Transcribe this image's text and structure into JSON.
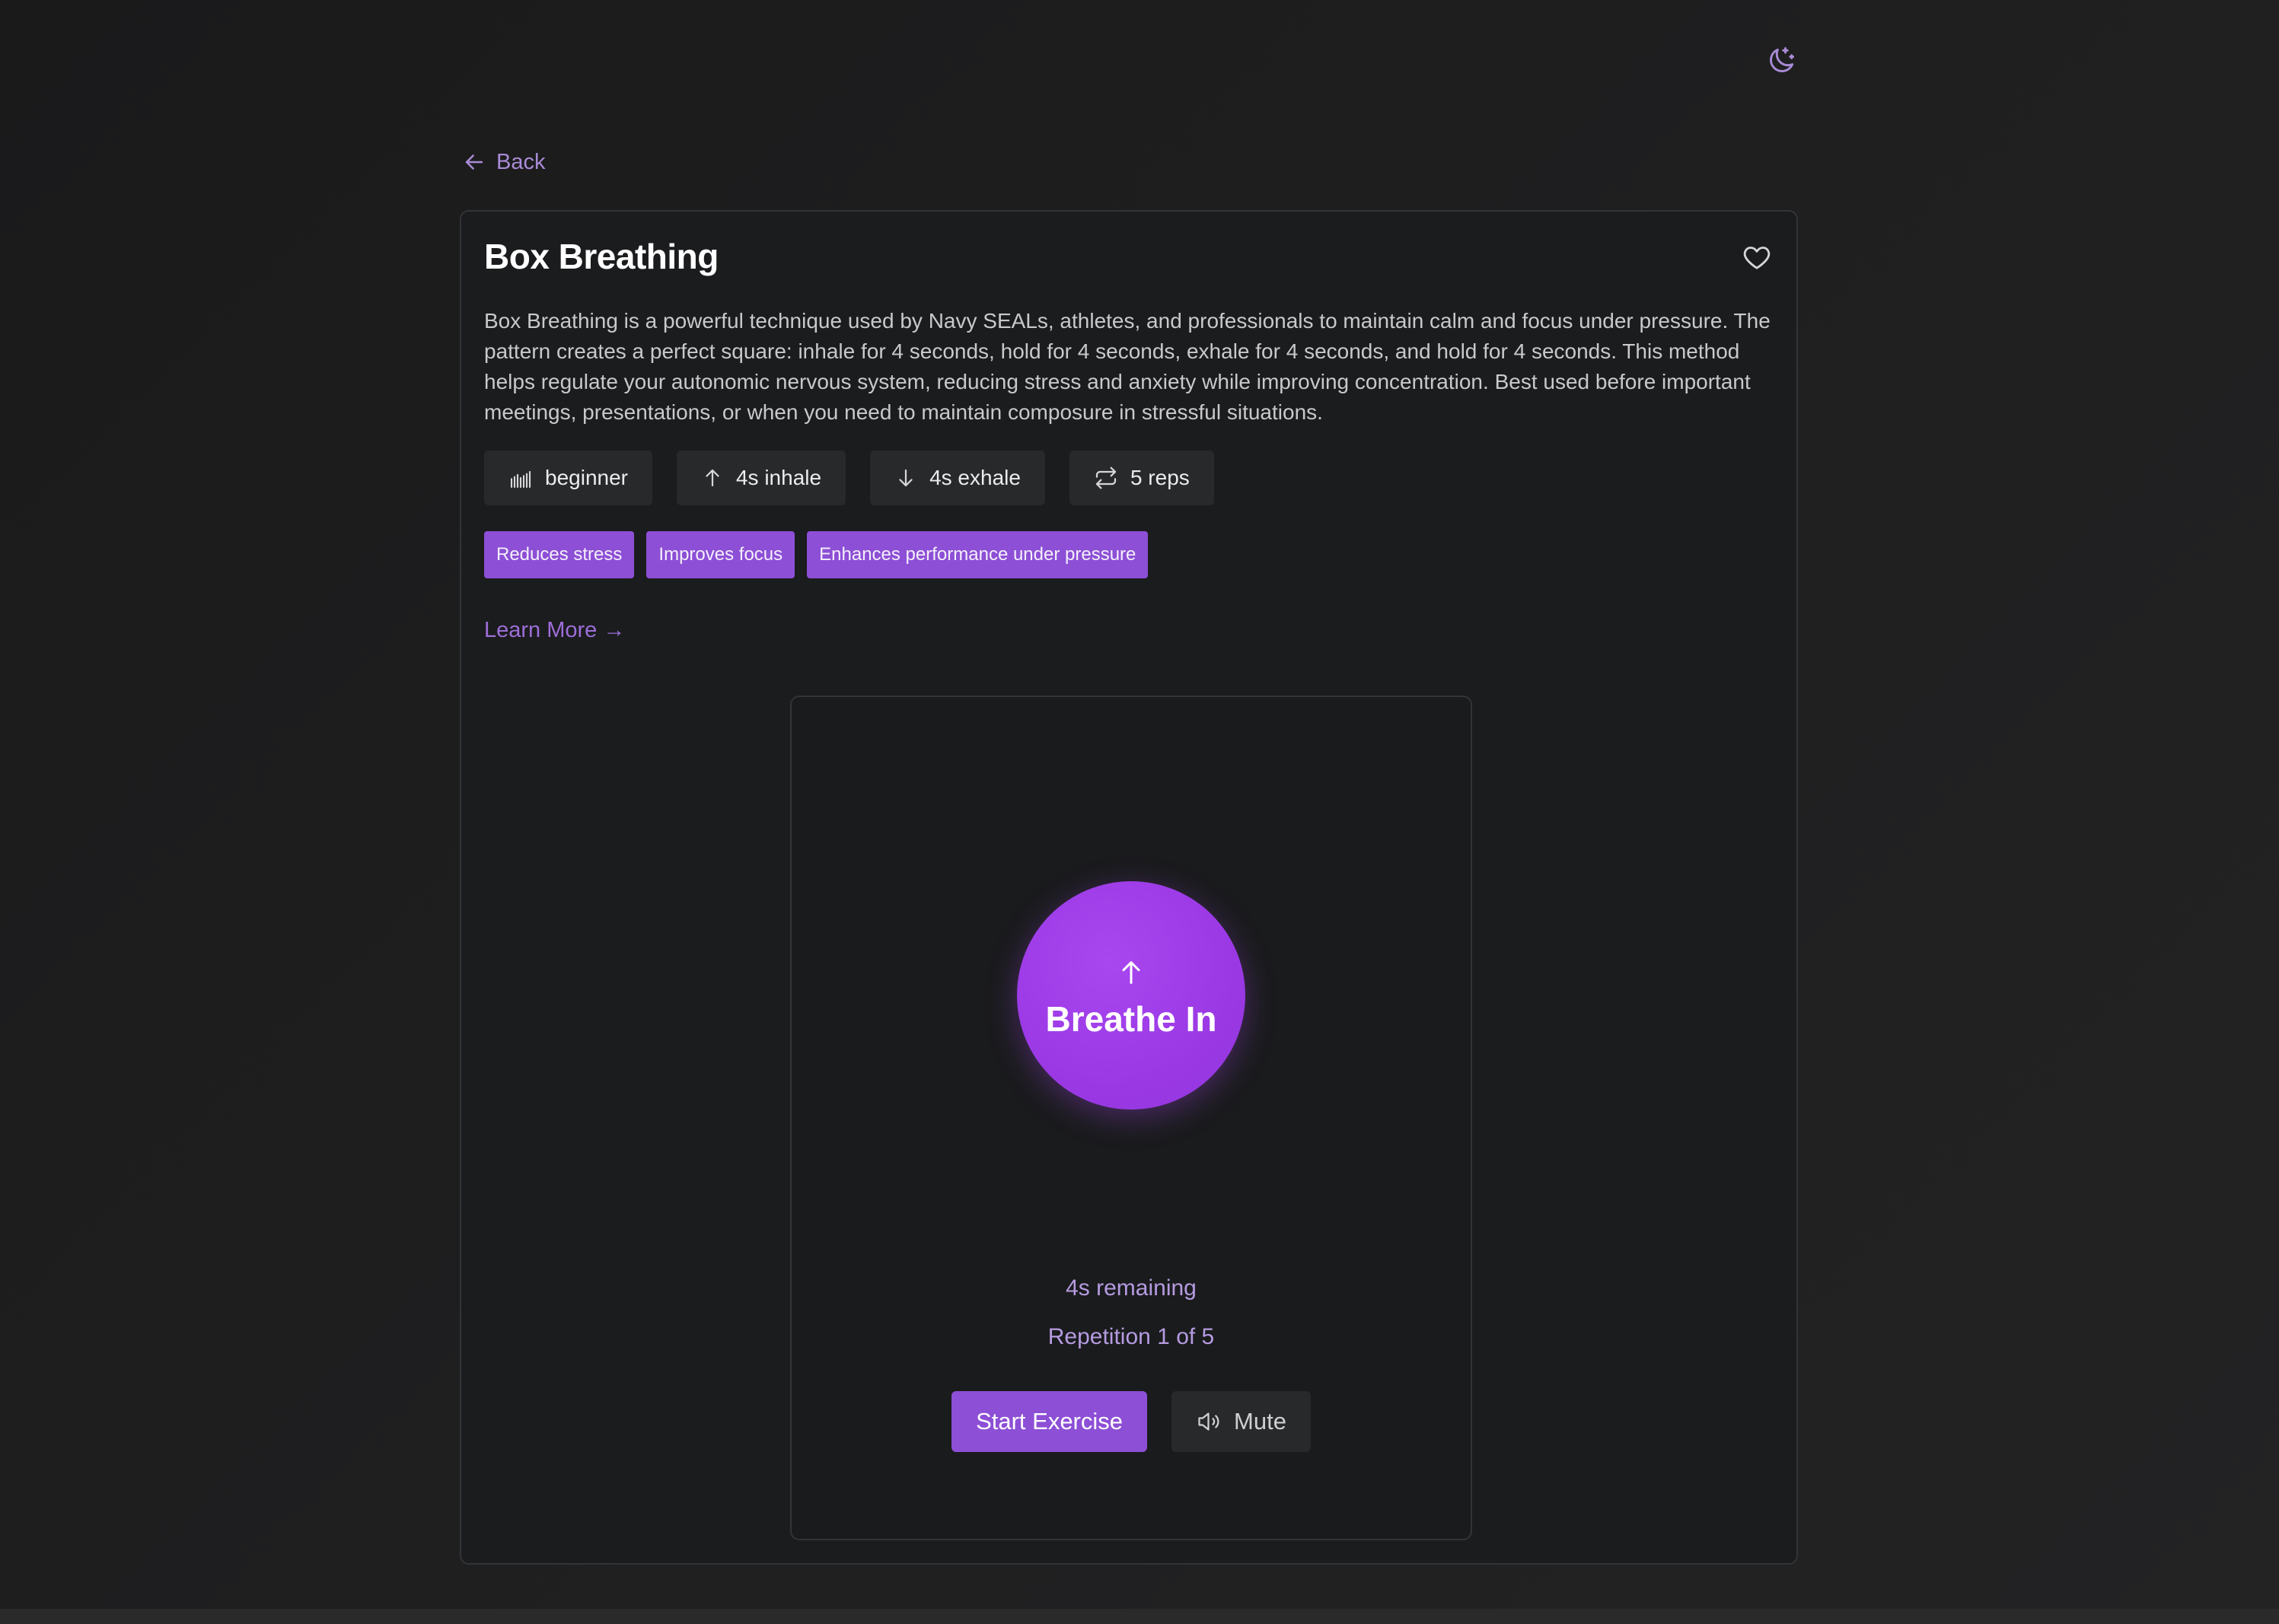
{
  "header": {
    "theme_toggle_icon": "moon-stars-icon"
  },
  "nav": {
    "back_label": "Back",
    "back_icon": "arrow-left-icon"
  },
  "exercise": {
    "title": "Box Breathing",
    "favorite_icon": "heart-icon",
    "description": "Box Breathing is a powerful technique used by Navy SEALs, athletes, and professionals to maintain calm and focus under pressure. The pattern creates a perfect square: inhale for 4 seconds, hold for 4 seconds, exhale for 4 seconds, and hold for 4 seconds. This method helps regulate your autonomic nervous system, reducing stress and anxiety while improving concentration. Best used before important meetings, presentations, or when you need to maintain composure in stressful situations.",
    "stats": [
      {
        "icon": "bar-chart-icon",
        "label": "beginner"
      },
      {
        "icon": "arrow-up-icon",
        "label": "4s inhale"
      },
      {
        "icon": "arrow-down-icon",
        "label": "4s exhale"
      },
      {
        "icon": "repeat-icon",
        "label": "5 reps"
      }
    ],
    "benefits": [
      "Reduces stress",
      "Improves focus",
      "Enhances performance under pressure"
    ],
    "learn_more_label": "Learn More →"
  },
  "player": {
    "phase_icon": "arrow-up-icon",
    "phase_label": "Breathe In",
    "remaining_text": "4s remaining",
    "repetition_text": "Repetition 1 of 5",
    "start_label": "Start Exercise",
    "mute_label": "Mute",
    "mute_icon": "speaker-icon"
  },
  "colors": {
    "background": "#1d1d1e",
    "card_background": "#1b1c1e",
    "card_border": "#333437",
    "accent": "#8d4fd6",
    "orb": "#9c3ae6",
    "link": "#a98bd6",
    "muted_text": "#b59be0"
  }
}
